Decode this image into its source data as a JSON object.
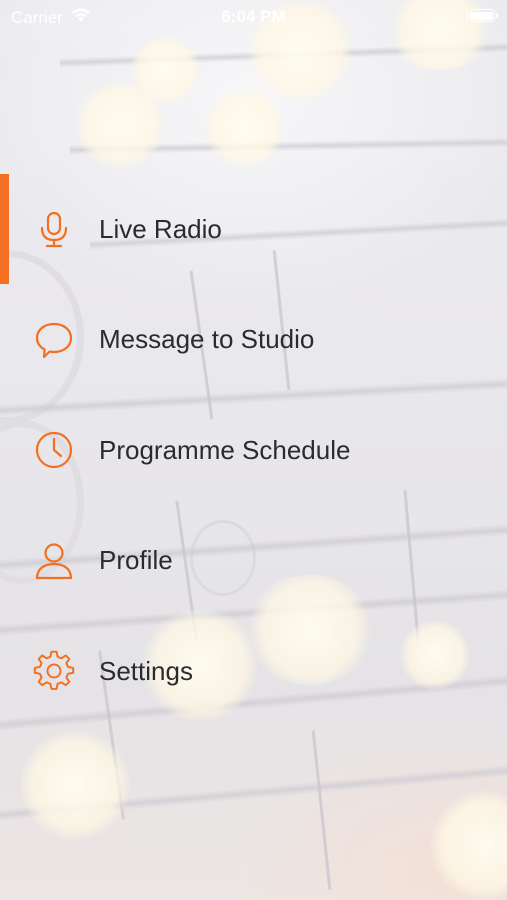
{
  "status_bar": {
    "carrier": "Carrier",
    "time": "6:04 PM",
    "wifi_icon": "wifi-icon",
    "battery_icon": "battery-icon"
  },
  "menu": {
    "active_index": 0,
    "accent_color": "#f36f21",
    "items": [
      {
        "label": "Live Radio",
        "icon": "microphone-icon"
      },
      {
        "label": "Message to Studio",
        "icon": "chat-bubble-icon"
      },
      {
        "label": "Programme Schedule",
        "icon": "clock-icon"
      },
      {
        "label": "Profile",
        "icon": "user-icon"
      },
      {
        "label": "Settings",
        "icon": "gear-icon"
      }
    ]
  }
}
